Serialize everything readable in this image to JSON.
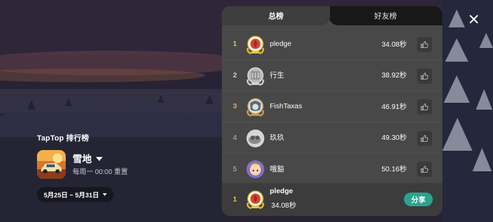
{
  "brand": "TapTop 排行榜",
  "game": {
    "name": "雪地",
    "reset": "每周一 00:00 重置",
    "date_range": "5月25日 ~ 5月31日"
  },
  "tabs": [
    {
      "label": "总榜",
      "active": true
    },
    {
      "label": "好友榜",
      "active": false
    }
  ],
  "leaderboard": [
    {
      "rank": "1",
      "name": "pledge",
      "score": "34.08秒",
      "medal": "gold"
    },
    {
      "rank": "2",
      "name": "行生",
      "score": "38.92秒",
      "medal": "silver"
    },
    {
      "rank": "3",
      "name": "FishTaxas",
      "score": "46.91秒",
      "medal": "bronze"
    },
    {
      "rank": "4",
      "name": "玖玖",
      "score": "49.30秒",
      "medal": "none"
    },
    {
      "rank": "5",
      "name": "哦豁",
      "score": "50.16秒",
      "medal": "none"
    }
  ],
  "my_entry": {
    "rank": "1",
    "name": "pledge",
    "score": "34.08秒"
  },
  "share_label": "分享",
  "colors": {
    "panel_bg": "#484848",
    "accent_share": "#2aa58d",
    "gold": "#f2c23b"
  }
}
